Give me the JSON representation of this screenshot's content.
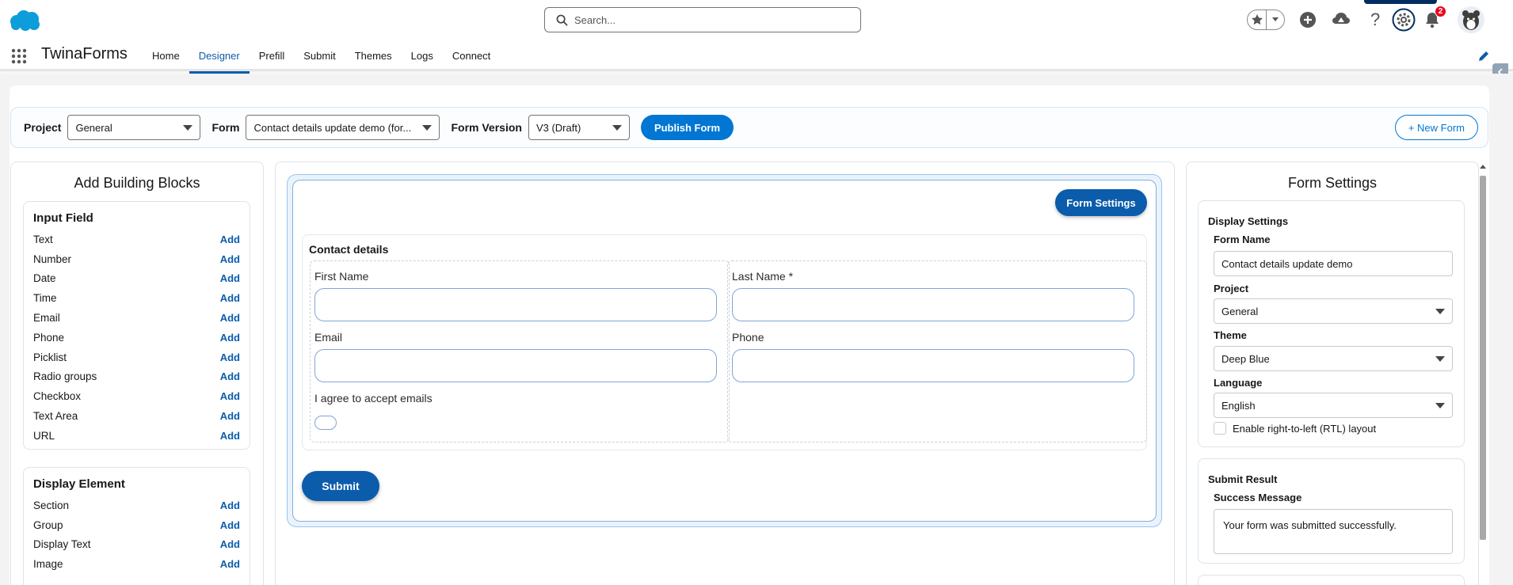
{
  "header": {
    "search_placeholder": "Search...",
    "notification_count": "2"
  },
  "app": {
    "name": "TwinaForms",
    "tabs": [
      {
        "label": "Home"
      },
      {
        "label": "Designer"
      },
      {
        "label": "Prefill"
      },
      {
        "label": "Submit"
      },
      {
        "label": "Themes"
      },
      {
        "label": "Logs"
      },
      {
        "label": "Connect"
      }
    ],
    "active_tab": "Designer"
  },
  "toolbar": {
    "project_label": "Project",
    "project_value": "General",
    "form_label": "Form",
    "form_value": "Contact details update demo (for...",
    "version_label": "Form Version",
    "version_value": "V3 (Draft)",
    "publish_label": "Publish Form",
    "new_form_label": "+ New Form"
  },
  "building_blocks": {
    "title": "Add Building Blocks",
    "add_label": "Add",
    "input_field": {
      "title": "Input Field",
      "items": [
        "Text",
        "Number",
        "Date",
        "Time",
        "Email",
        "Phone",
        "Picklist",
        "Radio groups",
        "Checkbox",
        "Text Area",
        "URL"
      ]
    },
    "display_element": {
      "title": "Display Element",
      "items": [
        "Section",
        "Group",
        "Display Text",
        "Image"
      ]
    }
  },
  "canvas": {
    "form_settings_label": "Form Settings",
    "section_title": "Contact details",
    "fields": {
      "first_name": "First Name",
      "last_name": "Last Name *",
      "email": "Email",
      "phone": "Phone",
      "agree": "I agree to accept emails"
    },
    "submit_label": "Submit"
  },
  "settings": {
    "title": "Form Settings",
    "display": {
      "title": "Display Settings",
      "form_name_label": "Form Name",
      "form_name_value": "Contact details update demo",
      "project_label": "Project",
      "project_value": "General",
      "theme_label": "Theme",
      "theme_value": "Deep Blue",
      "language_label": "Language",
      "language_value": "English",
      "rtl_label": "Enable right-to-left (RTL) layout",
      "rtl_checked": false
    },
    "submit_result": {
      "title": "Submit Result",
      "success_label": "Success Message",
      "success_value": "Your form was submitted successfully."
    }
  },
  "colors": {
    "brand": "#0176d3",
    "brand_dark": "#0b5cab",
    "badge": "#ea001e"
  }
}
